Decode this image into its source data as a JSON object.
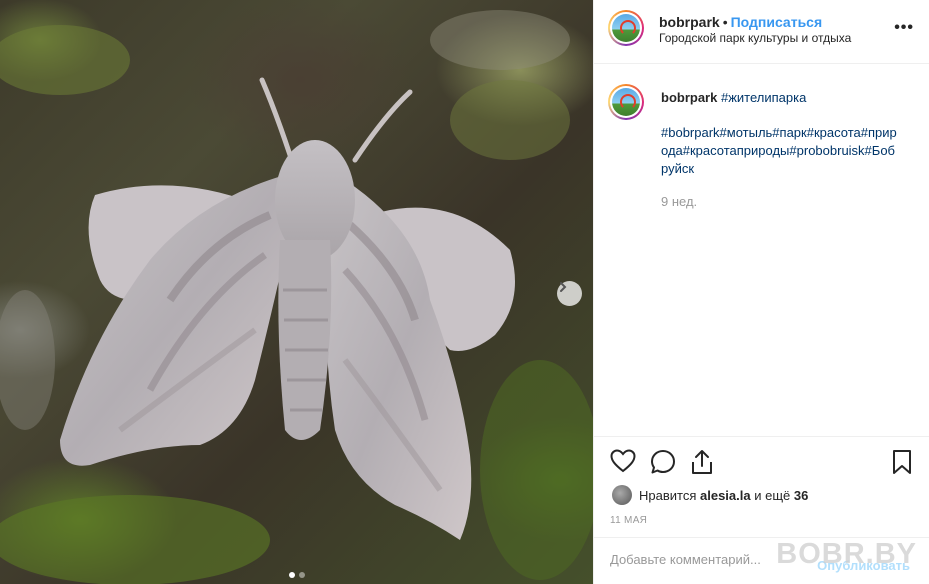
{
  "photo": {
    "alt_icon": "moth-photo",
    "nav_arrow_icon": "chevron-right-icon",
    "carousel_dots": 2,
    "active_dot": 0
  },
  "header": {
    "username": "bobrpark",
    "separator": "•",
    "follow_label": "Подписаться",
    "location": "Городской парк культуры и отдыха",
    "more_icon": "more-dots-icon",
    "more_label": "•••"
  },
  "caption": {
    "username": "bobrpark",
    "first_tag": "#жителипарка",
    "tags_text": "#bobrpark#мотыль#парк#красота#природа#красотаприроды#probobruisk#Бобруйск",
    "time_ago": "9 нед."
  },
  "actions": {
    "like_icon": "heart-icon",
    "comment_icon": "comment-icon",
    "share_icon": "share-icon",
    "save_icon": "bookmark-icon"
  },
  "likes": {
    "prefix": "Нравится",
    "user": "alesia.la",
    "middle": "и ещё",
    "count": "36"
  },
  "date": "11 МАЯ",
  "comment": {
    "placeholder": "Добавьте комментарий...",
    "publish_label": "Опубликовать"
  },
  "watermark": "BOBR.BY",
  "colors": {
    "accent_blue": "#3897f0",
    "tag_blue": "#003569",
    "muted_gray": "#999999",
    "publish_disabled": "#b2dffc"
  }
}
